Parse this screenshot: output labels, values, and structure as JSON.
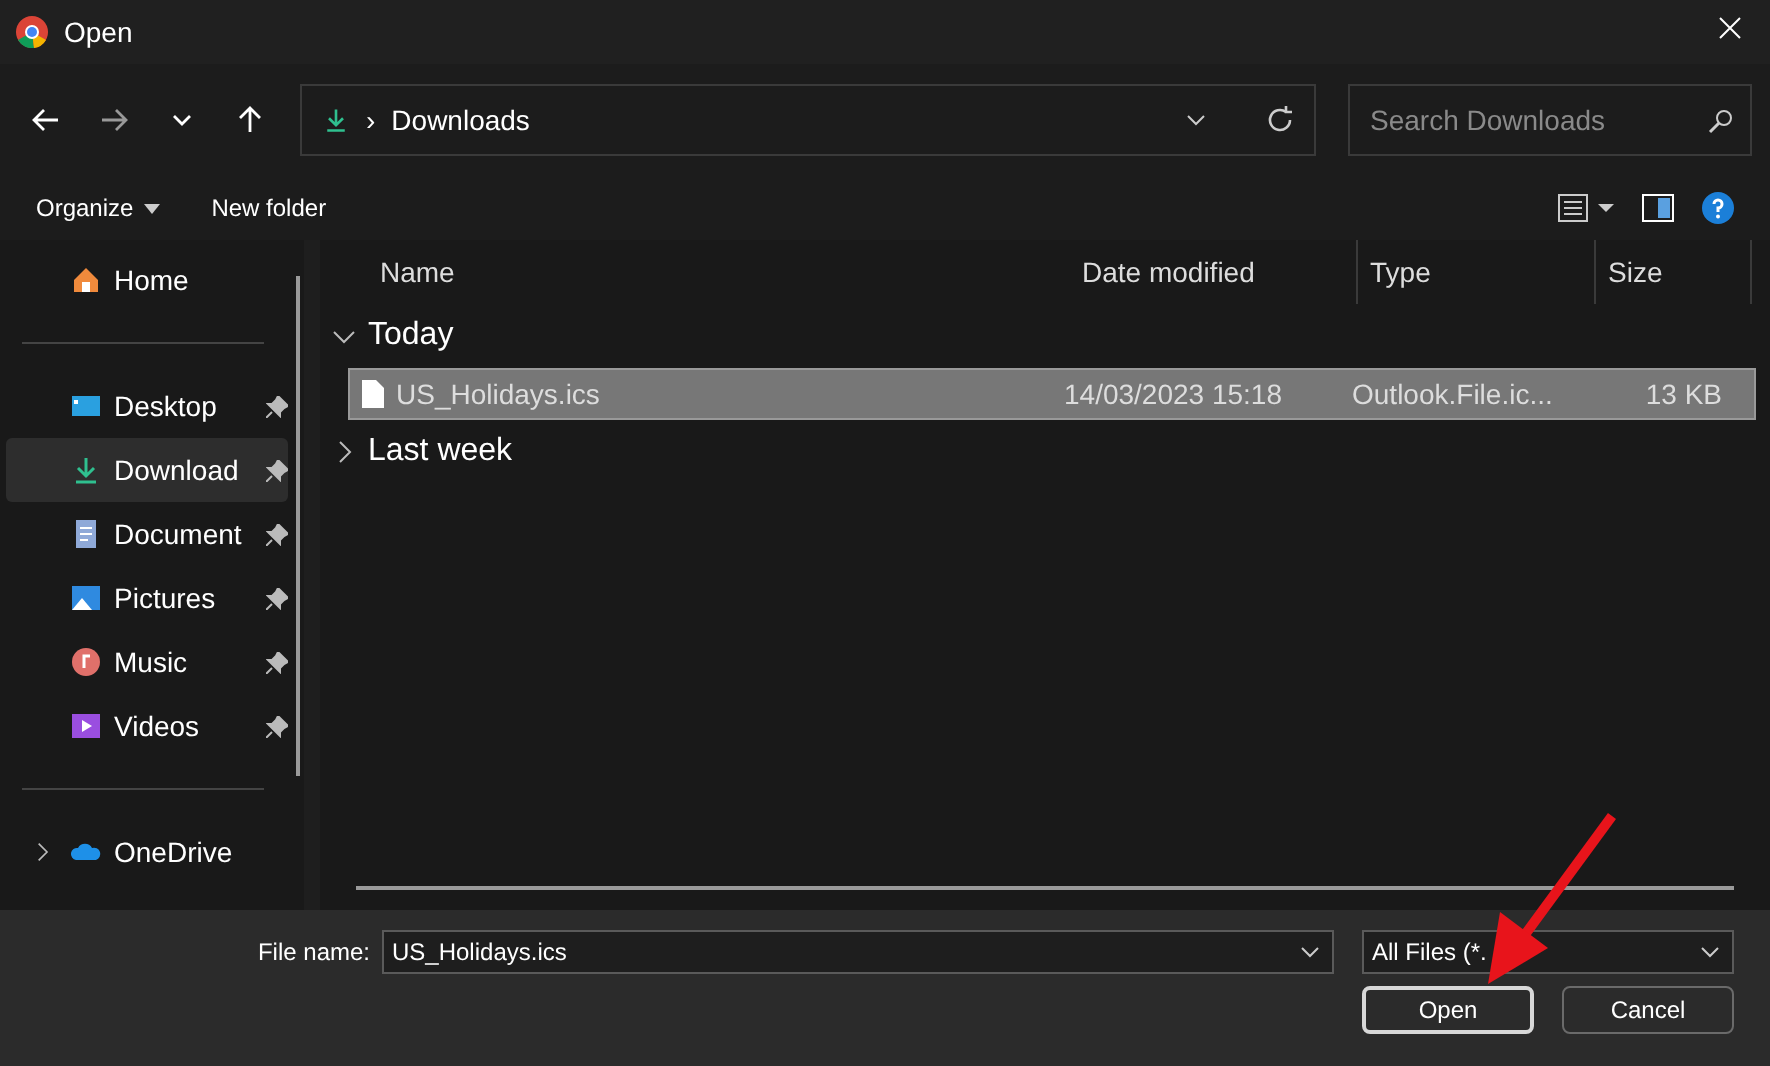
{
  "window": {
    "title": "Open"
  },
  "address_bar": {
    "separator": "›",
    "path": "Downloads",
    "search_placeholder": "Search Downloads"
  },
  "toolbar": {
    "organize": "Organize",
    "new_folder": "New folder"
  },
  "sidebar": {
    "items": [
      {
        "label": "Home",
        "kind": "home",
        "pinned": false,
        "selected": false,
        "expandable": false
      },
      {
        "kind": "separator"
      },
      {
        "label": "Desktop",
        "kind": "desktop",
        "pinned": true,
        "selected": false,
        "expandable": false
      },
      {
        "label": "Download",
        "kind": "download",
        "pinned": true,
        "selected": true,
        "expandable": false
      },
      {
        "label": "Document",
        "kind": "documents",
        "pinned": true,
        "selected": false,
        "expandable": false
      },
      {
        "label": "Pictures",
        "kind": "pictures",
        "pinned": true,
        "selected": false,
        "expandable": false
      },
      {
        "label": "Music",
        "kind": "music",
        "pinned": true,
        "selected": false,
        "expandable": false
      },
      {
        "label": "Videos",
        "kind": "videos",
        "pinned": true,
        "selected": false,
        "expandable": false
      },
      {
        "kind": "separator"
      },
      {
        "label": "OneDrive",
        "kind": "cloud",
        "pinned": false,
        "selected": false,
        "expandable": true
      }
    ]
  },
  "table": {
    "columns": [
      "Name",
      "Date modified",
      "Type",
      "Size"
    ],
    "groups": [
      {
        "label": "Today",
        "expanded": true,
        "rows": [
          {
            "name": "US_Holidays.ics",
            "date": "14/03/2023 15:18",
            "type": "Outlook.File.ic...",
            "size": "13 KB",
            "selected": true
          }
        ]
      },
      {
        "label": "Last week",
        "expanded": false
      }
    ]
  },
  "footer": {
    "file_name_label": "File name:",
    "file_name": "US_Holidays.ics",
    "filter": "All Files (*.",
    "buttons": [
      "Open",
      "Cancel"
    ]
  }
}
